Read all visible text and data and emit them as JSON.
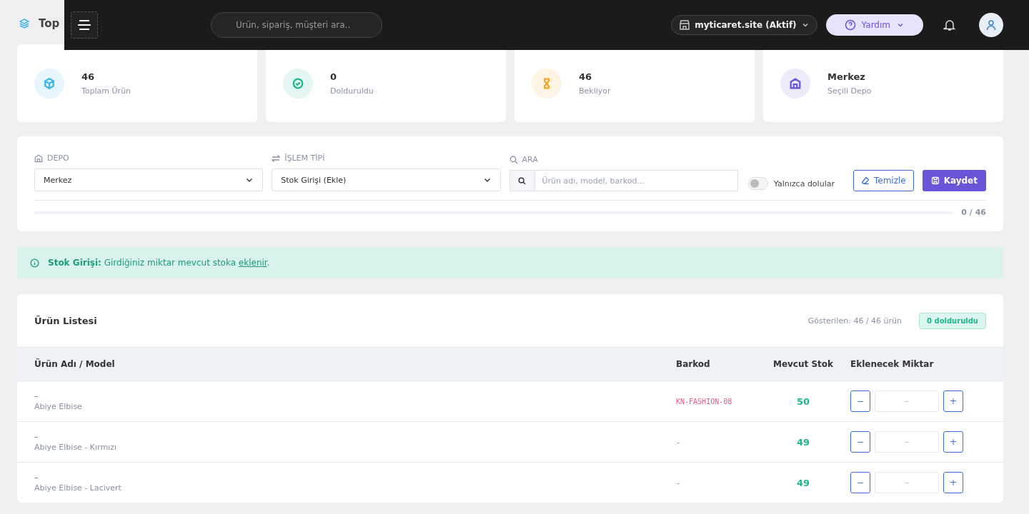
{
  "page_title": "Top",
  "topbar": {
    "search": {
      "placeholder": "Ürün, sipariş, müşteri ara.."
    },
    "store": "myticaret.site (Aktif)",
    "help": "Yardım"
  },
  "stats": [
    {
      "kind": "box",
      "value": "46",
      "label": "Toplam Ürün",
      "color": "#3bb4e6"
    },
    {
      "kind": "check",
      "value": "0",
      "label": "Dolduruldu",
      "color": "#1fb88a"
    },
    {
      "kind": "hourglass",
      "value": "46",
      "label": "Bekliyor",
      "color": "#f5a524"
    },
    {
      "kind": "warehouse",
      "value": "Merkez",
      "label": "Seçili Depo",
      "color": "#6a55d8"
    }
  ],
  "filters": {
    "depo": {
      "label": "DEPO",
      "value": "Merkez"
    },
    "islem": {
      "label": "İŞLEM TİPİ",
      "value": "Stok Girişi (Ekle)"
    },
    "ara": {
      "label": "ARA",
      "placeholder": "Ürün adı, model, barkod..."
    },
    "only_filled": {
      "label": "Yalnızca dolular",
      "checked": false
    },
    "clear": "Temizle",
    "save": "Kaydet",
    "progress": {
      "level": 0,
      "reading": "0 / 46"
    }
  },
  "alert": "**Stok Girişi:** Girdiğiniz miktar mevcut stoka ",
  "alert_link": "eklenir",
  "alert_end": ".",
  "table": {
    "title": "Ürün Listesi",
    "shown": "Gösterilen: 46 / 46 ürün",
    "badge": "0 dolduruldu",
    "columns": [
      "Ürün Adı / Model",
      "Barkod",
      "Mevcut Stok",
      "Eklenecek Miktar"
    ],
    "rows": [
      {
        "name": "–",
        "model": "Abiye Elbise",
        "barcode": "KN-FASHION-08",
        "stock": "50",
        "qty_placeholder": "–",
        "minus": "−",
        "plus": "+"
      },
      {
        "name": "–",
        "model": "Abiye Elbise - Kırmızı",
        "barcode": "-",
        "stock": "49",
        "qty_placeholder": "–",
        "minus": "−",
        "plus": "+"
      },
      {
        "name": "–",
        "model": "Abiye Elbise - Lacivert",
        "barcode": "-",
        "stock": "49",
        "qty_placeholder": "–",
        "minus": "−",
        "plus": "+"
      }
    ]
  }
}
